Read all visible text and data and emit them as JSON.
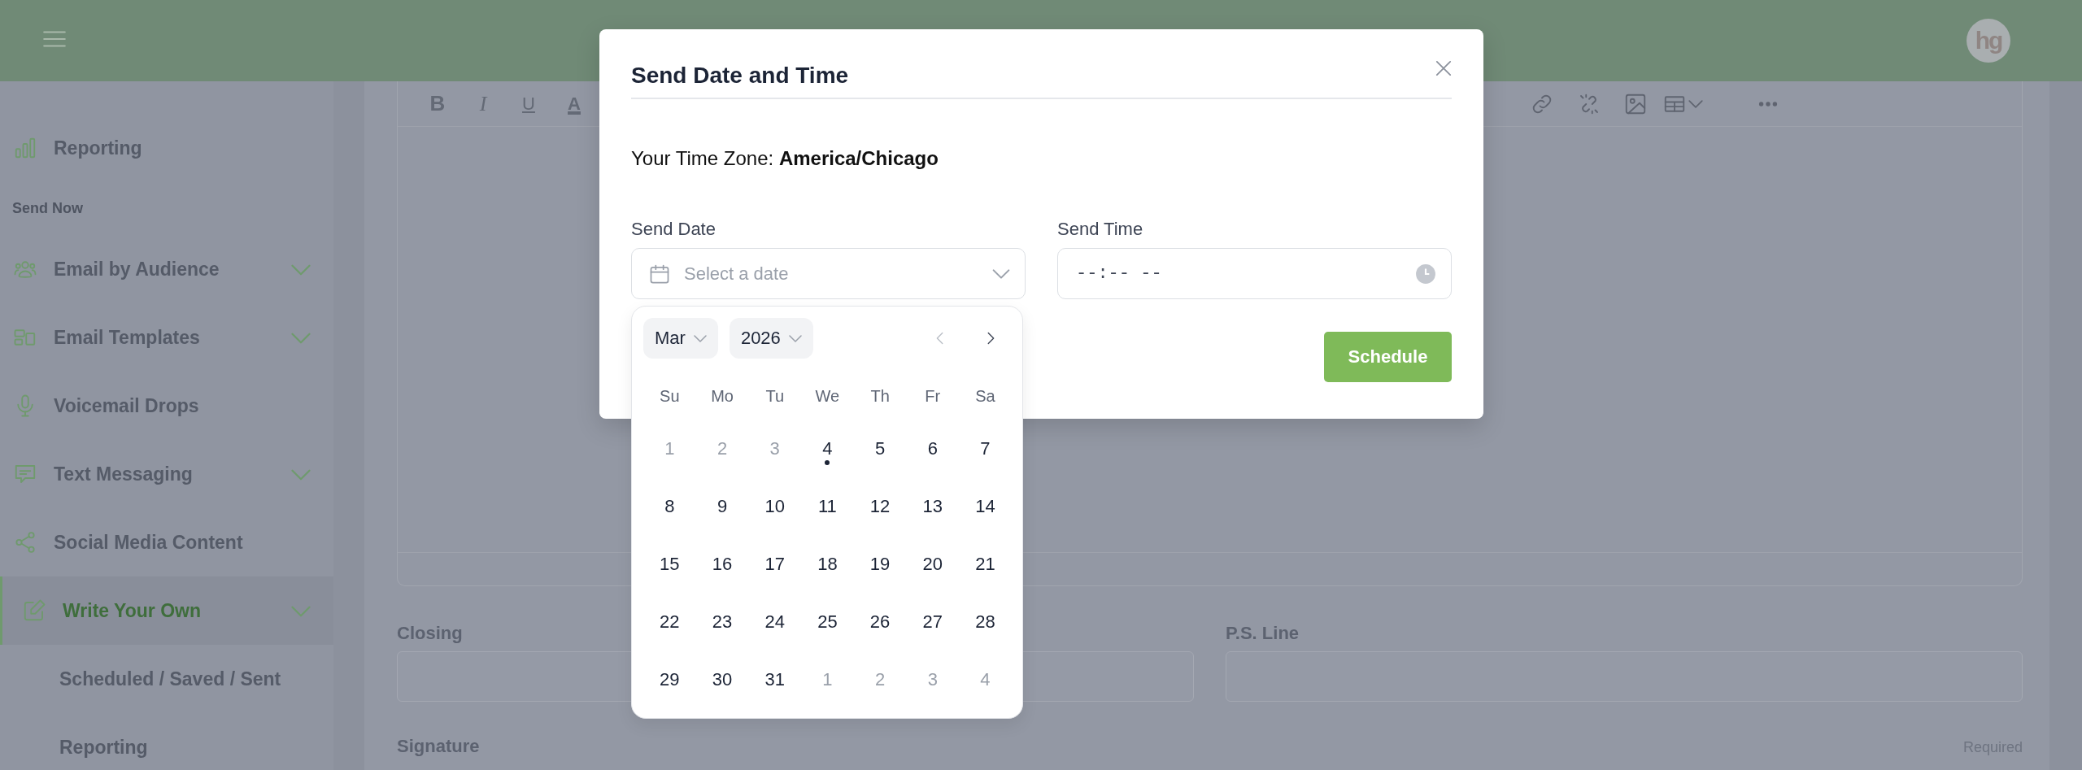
{
  "header": {
    "avatar_text": "hg"
  },
  "sidebar": {
    "items": [
      {
        "label": "Reporting",
        "kind": "item",
        "expandable": false,
        "selected": false
      },
      {
        "label": "Send Now",
        "kind": "section"
      },
      {
        "label": "Email by Audience",
        "kind": "item",
        "expandable": true,
        "selected": false
      },
      {
        "label": "Email Templates",
        "kind": "item",
        "expandable": true,
        "selected": false
      },
      {
        "label": "Voicemail Drops",
        "kind": "item",
        "expandable": false,
        "selected": false
      },
      {
        "label": "Text Messaging",
        "kind": "item",
        "expandable": true,
        "selected": false
      },
      {
        "label": "Social Media Content",
        "kind": "item",
        "expandable": false,
        "selected": false
      },
      {
        "label": "Write Your Own",
        "kind": "item",
        "expandable": true,
        "selected": true
      },
      {
        "label": "Scheduled / Saved / Sent",
        "kind": "subitem",
        "selected": false
      },
      {
        "label": "Reporting",
        "kind": "subitem",
        "selected": false
      }
    ]
  },
  "editor": {
    "format_buttons": [
      "B",
      "I",
      "U",
      "A"
    ]
  },
  "form": {
    "fields": [
      {
        "label": "Closing"
      },
      {
        "label": "P.S. Line"
      }
    ],
    "signature": {
      "label": "Signature",
      "note": "Required"
    }
  },
  "modal": {
    "title": "Send Date and Time",
    "timezone": "Your Time Zone: **America/Chicago**",
    "date_field": {
      "label": "Send Date",
      "placeholder": "Select a date"
    },
    "time_field": {
      "label": "Send Time",
      "placeholder": "--:-- --"
    },
    "button": "Schedule",
    "calendar": {
      "month": "Mar",
      "year": "2026",
      "prev_disabled": true,
      "weekdays": [
        "Su",
        "Mo",
        "Tu",
        "We",
        "Th",
        "Fr",
        "Sa"
      ],
      "days": [
        {
          "day": "1",
          "disabled": true,
          "today": false
        },
        {
          "day": "2",
          "disabled": true,
          "today": false
        },
        {
          "day": "3",
          "disabled": true,
          "today": false
        },
        {
          "day": "4",
          "disabled": false,
          "today": true
        },
        {
          "day": "5",
          "disabled": false,
          "today": false
        },
        {
          "day": "6",
          "disabled": false,
          "today": false
        },
        {
          "day": "7",
          "disabled": false,
          "today": false
        },
        {
          "day": "8",
          "disabled": false,
          "today": false
        },
        {
          "day": "9",
          "disabled": false,
          "today": false
        },
        {
          "day": "10",
          "disabled": false,
          "today": false
        },
        {
          "day": "11",
          "disabled": false,
          "today": false
        },
        {
          "day": "12",
          "disabled": false,
          "today": false
        },
        {
          "day": "13",
          "disabled": false,
          "today": false
        },
        {
          "day": "14",
          "disabled": false,
          "today": false
        },
        {
          "day": "15",
          "disabled": false,
          "today": false
        },
        {
          "day": "16",
          "disabled": false,
          "today": false
        },
        {
          "day": "17",
          "disabled": false,
          "today": false
        },
        {
          "day": "18",
          "disabled": false,
          "today": false
        },
        {
          "day": "19",
          "disabled": false,
          "today": false
        },
        {
          "day": "20",
          "disabled": false,
          "today": false
        },
        {
          "day": "21",
          "disabled": false,
          "today": false
        },
        {
          "day": "22",
          "disabled": false,
          "today": false
        },
        {
          "day": "23",
          "disabled": false,
          "today": false
        },
        {
          "day": "24",
          "disabled": false,
          "today": false
        },
        {
          "day": "25",
          "disabled": false,
          "today": false
        },
        {
          "day": "26",
          "disabled": false,
          "today": false
        },
        {
          "day": "27",
          "disabled": false,
          "today": false
        },
        {
          "day": "28",
          "disabled": false,
          "today": false
        },
        {
          "day": "29",
          "disabled": false,
          "today": false
        },
        {
          "day": "30",
          "disabled": false,
          "today": false
        },
        {
          "day": "31",
          "disabled": false,
          "today": false
        },
        {
          "day": "1",
          "disabled": true,
          "today": false
        },
        {
          "day": "2",
          "disabled": true,
          "today": false
        },
        {
          "day": "3",
          "disabled": true,
          "today": false
        },
        {
          "day": "4",
          "disabled": true,
          "today": false
        }
      ]
    }
  }
}
